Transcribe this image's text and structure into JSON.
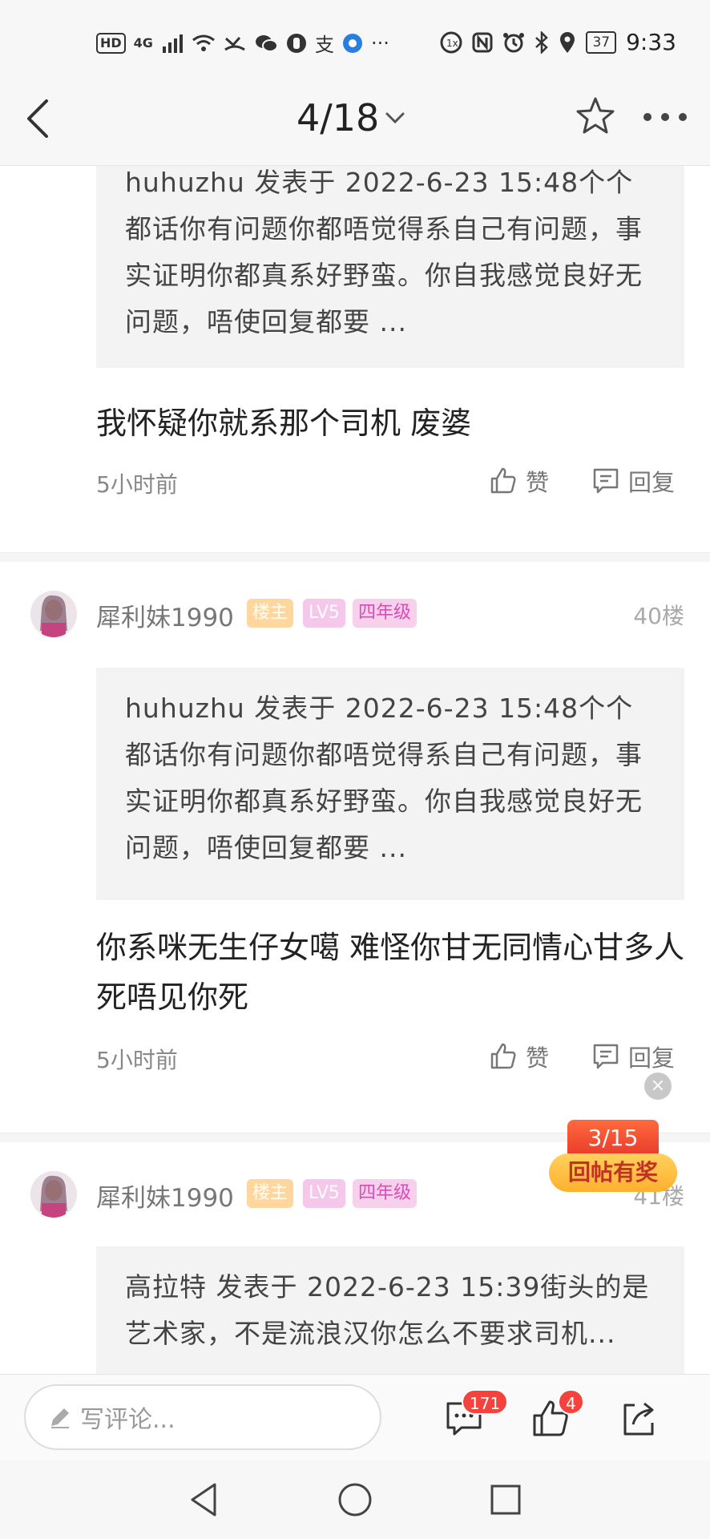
{
  "status_bar": {
    "left_badges": [
      "HD",
      "4G"
    ],
    "left_icons": [
      "signal-icon",
      "wifi-icon",
      "missed-call-icon",
      "wechat-icon",
      "hand-icon",
      "alipay-icon",
      "app-icon"
    ],
    "more_indicator": "···",
    "right_icons": [
      "1x-icon",
      "nfc-icon",
      "alarm-icon",
      "bluetooth-icon",
      "location-icon"
    ],
    "battery": "37",
    "time": "9:33"
  },
  "nav": {
    "page_indicator": "4/18",
    "icons": [
      "back-chevron-icon",
      "dropdown-chevron-icon",
      "star-icon",
      "more-dots-icon"
    ]
  },
  "posts": [
    {
      "quote": "huhuzhu 发表于 2022-6-23 15:48个个都话你有问题你都唔觉得系自己有问题，事实证明你都真系好野蛮。你自我感觉良好无问题，唔使回复都要 ...",
      "text": "我怀疑你就系那个司机 废婆",
      "time": "5小时前",
      "like_label": "赞",
      "reply_label": "回复"
    },
    {
      "author": "犀利妹1990",
      "tags": [
        "楼主",
        "LV5",
        "四年级"
      ],
      "floor": "40楼",
      "quote": "huhuzhu 发表于 2022-6-23 15:48个个都话你有问题你都唔觉得系自己有问题，事实证明你都真系好野蛮。你自我感觉良好无问题，唔使回复都要 ...",
      "text": "你系咪无生仔女噶 难怪你甘无同情心甘多人死唔见你死",
      "time": "5小时前",
      "like_label": "赞",
      "reply_label": "回复"
    },
    {
      "author": "犀利妹1990",
      "tags": [
        "楼主",
        "LV5",
        "四年级"
      ],
      "floor": "41楼",
      "quote": "高拉特 发表于 2022-6-23 15:39街头的是艺术家，不是流浪汉你怎么不要求司机..."
    }
  ],
  "promo": {
    "count": "3/15",
    "label": "回帖有奖",
    "close": "×"
  },
  "bottom_bar": {
    "comment_placeholder": "写评论...",
    "comment_count": "171",
    "like_count": "4"
  },
  "colors": {
    "accent_red": "#f4433c",
    "tag_owner": "#ffd79e",
    "tag_level": "#f5c7eb",
    "tag_grade_text": "#d64fb4"
  }
}
